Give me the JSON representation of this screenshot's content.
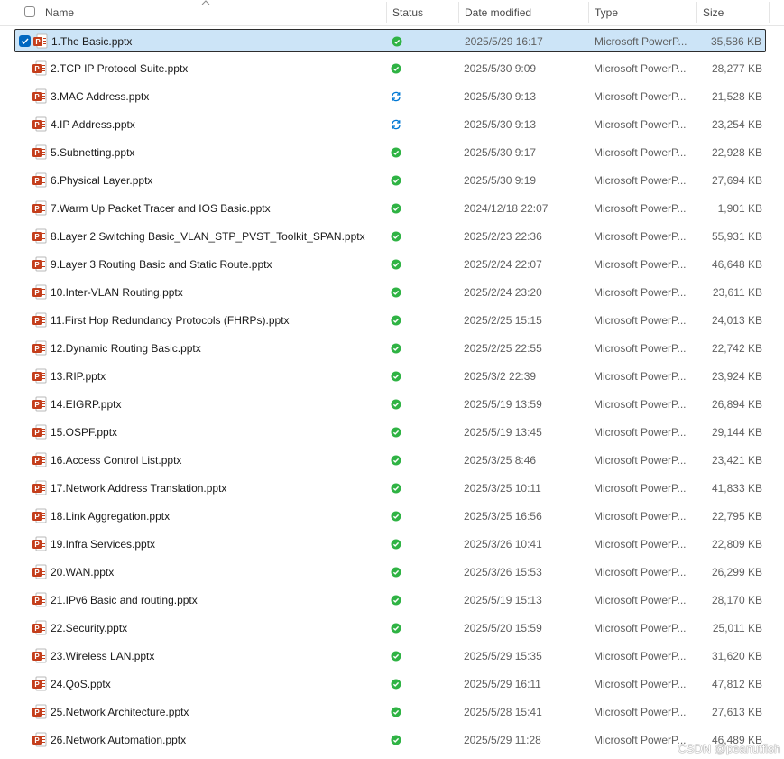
{
  "columns": {
    "name": "Name",
    "status": "Status",
    "date": "Date modified",
    "type": "Type",
    "size": "Size"
  },
  "colors": {
    "accent": "#0067c0",
    "selection": "#cce4f7",
    "status_ok": "#2fb344",
    "status_sync": "#0078d4",
    "ppt": "#c43e1c"
  },
  "files": [
    {
      "name": "1.The Basic.pptx",
      "status": "synced",
      "date": "2025/5/29 16:17",
      "type": "Microsoft PowerP...",
      "size": "35,586 KB",
      "selected": true
    },
    {
      "name": "2.TCP IP Protocol Suite.pptx",
      "status": "synced",
      "date": "2025/5/30 9:09",
      "type": "Microsoft PowerP...",
      "size": "28,277 KB"
    },
    {
      "name": "3.MAC Address.pptx",
      "status": "syncing",
      "date": "2025/5/30 9:13",
      "type": "Microsoft PowerP...",
      "size": "21,528 KB"
    },
    {
      "name": "4.IP Address.pptx",
      "status": "syncing",
      "date": "2025/5/30 9:13",
      "type": "Microsoft PowerP...",
      "size": "23,254 KB"
    },
    {
      "name": "5.Subnetting.pptx",
      "status": "synced",
      "date": "2025/5/30 9:17",
      "type": "Microsoft PowerP...",
      "size": "22,928 KB"
    },
    {
      "name": "6.Physical Layer.pptx",
      "status": "synced",
      "date": "2025/5/30 9:19",
      "type": "Microsoft PowerP...",
      "size": "27,694 KB"
    },
    {
      "name": "7.Warm Up Packet Tracer and IOS Basic.pptx",
      "status": "synced",
      "date": "2024/12/18 22:07",
      "type": "Microsoft PowerP...",
      "size": "1,901 KB"
    },
    {
      "name": "8.Layer 2 Switching Basic_VLAN_STP_PVST_Toolkit_SPAN.pptx",
      "status": "synced",
      "date": "2025/2/23 22:36",
      "type": "Microsoft PowerP...",
      "size": "55,931 KB"
    },
    {
      "name": "9.Layer 3 Routing Basic and Static Route.pptx",
      "status": "synced",
      "date": "2025/2/24 22:07",
      "type": "Microsoft PowerP...",
      "size": "46,648 KB"
    },
    {
      "name": "10.Inter-VLAN Routing.pptx",
      "status": "synced",
      "date": "2025/2/24 23:20",
      "type": "Microsoft PowerP...",
      "size": "23,611 KB"
    },
    {
      "name": "11.First Hop Redundancy Protocols (FHRPs).pptx",
      "status": "synced",
      "date": "2025/2/25 15:15",
      "type": "Microsoft PowerP...",
      "size": "24,013 KB"
    },
    {
      "name": "12.Dynamic Routing Basic.pptx",
      "status": "synced",
      "date": "2025/2/25 22:55",
      "type": "Microsoft PowerP...",
      "size": "22,742 KB"
    },
    {
      "name": "13.RIP.pptx",
      "status": "synced",
      "date": "2025/3/2 22:39",
      "type": "Microsoft PowerP...",
      "size": "23,924 KB"
    },
    {
      "name": "14.EIGRP.pptx",
      "status": "synced",
      "date": "2025/5/19 13:59",
      "type": "Microsoft PowerP...",
      "size": "26,894 KB"
    },
    {
      "name": "15.OSPF.pptx",
      "status": "synced",
      "date": "2025/5/19 13:45",
      "type": "Microsoft PowerP...",
      "size": "29,144 KB"
    },
    {
      "name": "16.Access Control List.pptx",
      "status": "synced",
      "date": "2025/3/25 8:46",
      "type": "Microsoft PowerP...",
      "size": "23,421 KB"
    },
    {
      "name": "17.Network Address Translation.pptx",
      "status": "synced",
      "date": "2025/3/25 10:11",
      "type": "Microsoft PowerP...",
      "size": "41,833 KB"
    },
    {
      "name": "18.Link Aggregation.pptx",
      "status": "synced",
      "date": "2025/3/25 16:56",
      "type": "Microsoft PowerP...",
      "size": "22,795 KB"
    },
    {
      "name": "19.Infra Services.pptx",
      "status": "synced",
      "date": "2025/3/26 10:41",
      "type": "Microsoft PowerP...",
      "size": "22,809 KB"
    },
    {
      "name": "20.WAN.pptx",
      "status": "synced",
      "date": "2025/3/26 15:53",
      "type": "Microsoft PowerP...",
      "size": "26,299 KB"
    },
    {
      "name": "21.IPv6 Basic and routing.pptx",
      "status": "synced",
      "date": "2025/5/19 15:13",
      "type": "Microsoft PowerP...",
      "size": "28,170 KB"
    },
    {
      "name": "22.Security.pptx",
      "status": "synced",
      "date": "2025/5/20 15:59",
      "type": "Microsoft PowerP...",
      "size": "25,011 KB"
    },
    {
      "name": "23.Wireless LAN.pptx",
      "status": "synced",
      "date": "2025/5/29 15:35",
      "type": "Microsoft PowerP...",
      "size": "31,620 KB"
    },
    {
      "name": "24.QoS.pptx",
      "status": "synced",
      "date": "2025/5/29 16:11",
      "type": "Microsoft PowerP...",
      "size": "47,812 KB"
    },
    {
      "name": "25.Network Architecture.pptx",
      "status": "synced",
      "date": "2025/5/28 15:41",
      "type": "Microsoft PowerP...",
      "size": "27,613 KB"
    },
    {
      "name": "26.Network Automation.pptx",
      "status": "synced",
      "date": "2025/5/29 11:28",
      "type": "Microsoft PowerP...",
      "size": "46,489 KB"
    }
  ],
  "watermark": "CSDN @peanutfish"
}
